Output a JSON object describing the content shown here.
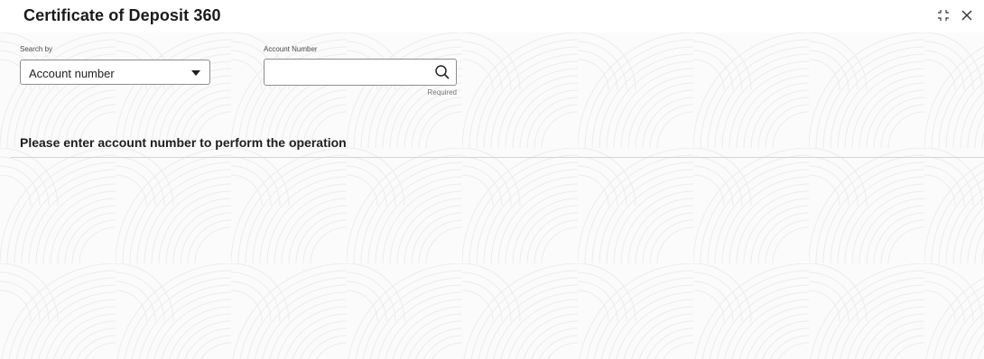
{
  "header": {
    "title": "Certificate of Deposit 360",
    "minimize_icon": "compress-icon",
    "close_icon": "close-icon"
  },
  "search": {
    "search_by_label": "Search by",
    "search_by_value": "Account number",
    "account_number_label": "Account Number",
    "account_number_value": "",
    "account_number_placeholder": "",
    "required_hint": "Required",
    "search_icon": "search-icon"
  },
  "message": "Please enter account number to perform the operation",
  "colors": {
    "background": "#fbfbfb",
    "header_background": "#ffffff",
    "text": "#1e1e1e",
    "border": "#8e8e8e",
    "divider": "#d4d4d4"
  }
}
